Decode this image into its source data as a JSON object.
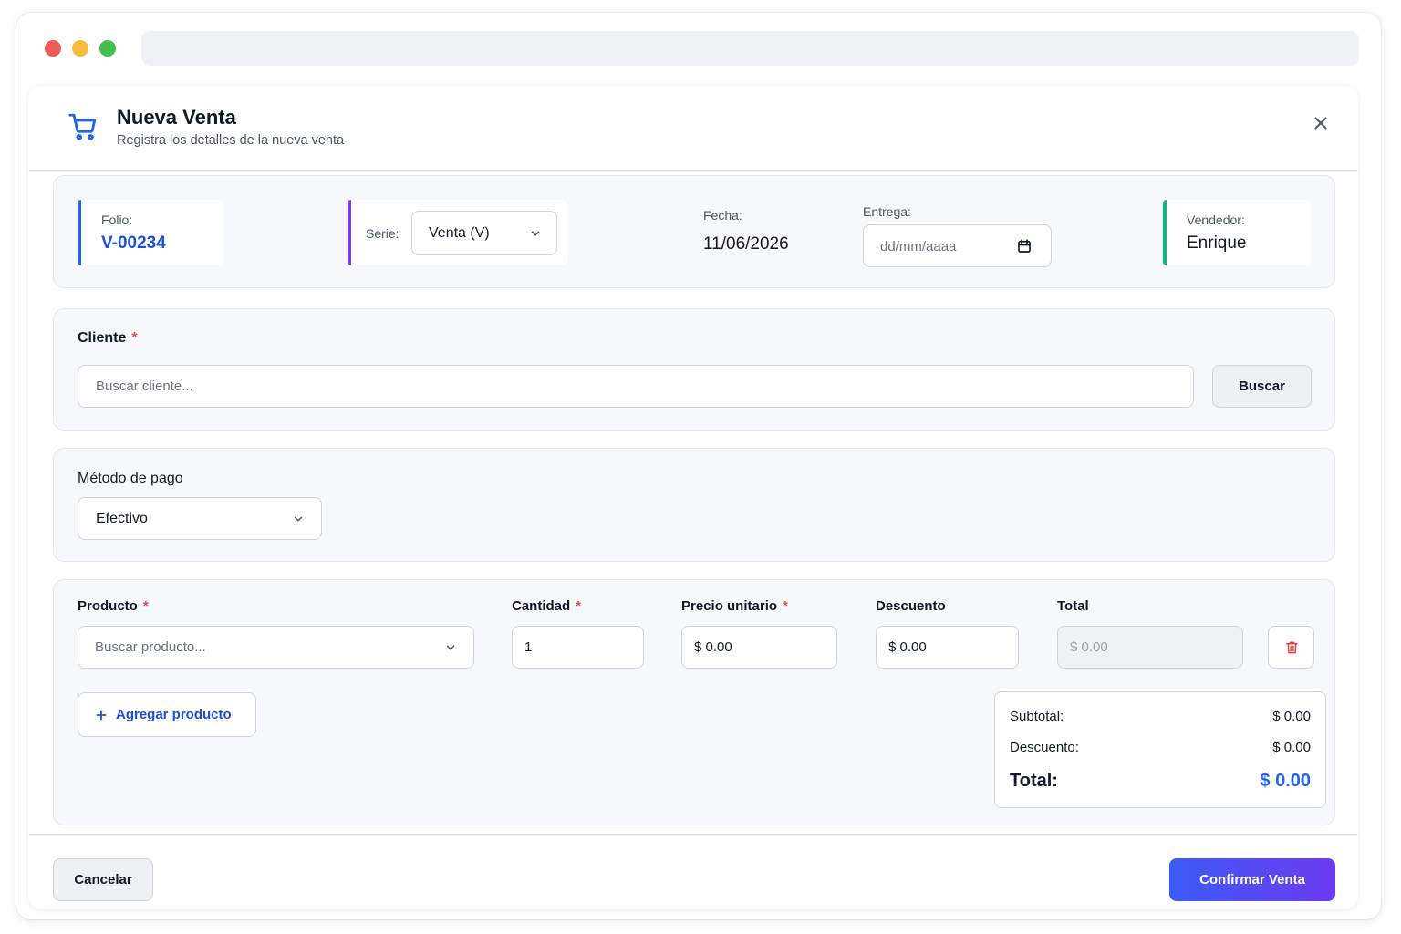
{
  "modal": {
    "title": "Nueva Venta",
    "subtitle": "Registra los detalles de la nueva venta"
  },
  "info": {
    "folio_label": "Folio:",
    "folio_value": "V-00234",
    "serie_label": "Serie:",
    "serie_value": "Venta (V)",
    "fecha_label": "Fecha:",
    "fecha_value": "11/06/2026",
    "entrega_label": "Entrega:",
    "entrega_placeholder": "dd/mm/aaaa",
    "vendedor_label": "Vendedor:",
    "vendedor_value": "Enrique"
  },
  "cliente": {
    "label": "Cliente",
    "required_mark": "*",
    "placeholder": "Buscar cliente...",
    "buscar_label": "Buscar"
  },
  "pago": {
    "label": "Método de pago",
    "value": "Efectivo"
  },
  "productos": {
    "headers": {
      "producto": "Producto",
      "cantidad": "Cantidad",
      "precio": "Precio unitario",
      "descuento": "Descuento",
      "total": "Total"
    },
    "required_mark": "*",
    "row": {
      "producto_placeholder": "Buscar producto...",
      "cantidad": "1",
      "precio": "$ 0.00",
      "descuento": "$ 0.00",
      "total": "$ 0.00"
    },
    "agregar_label": "Agregar producto"
  },
  "summary": {
    "subtotal_label": "Subtotal:",
    "subtotal_value": "$ 0.00",
    "descuento_label": "Descuento:",
    "descuento_value": "$ 0.00",
    "total_label": "Total:",
    "total_value": "$ 0.00"
  },
  "footer": {
    "cancel_label": "Cancelar",
    "confirm_label": "Confirmar Venta"
  },
  "colors": {
    "primary": "#2563eb",
    "folio_accent": "#2563eb",
    "serie_accent": "#7c3aed",
    "vendedor_accent": "#10b981",
    "required": "#ef4444",
    "delete": "#ef4444"
  }
}
